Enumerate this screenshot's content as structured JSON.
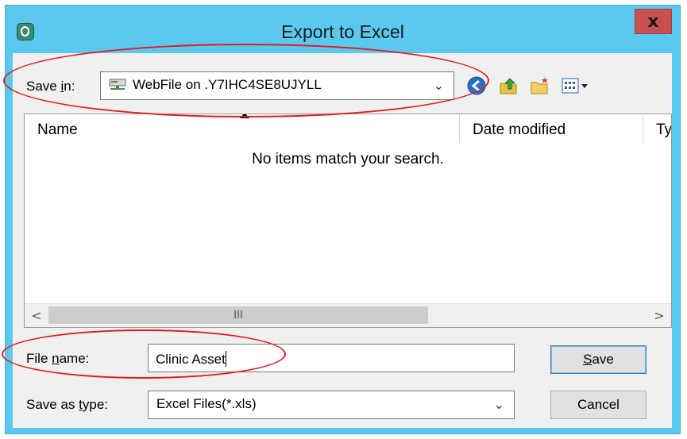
{
  "window": {
    "title": "Export to Excel",
    "close_label": "x"
  },
  "save_in": {
    "label_pre": "Save ",
    "label_accel": "i",
    "label_post": "n:",
    "value": "WebFile on .Y7IHC4SE8UJYLL",
    "location_icon": "network-drive-icon"
  },
  "toolbar": {
    "icons": [
      "back-icon",
      "up-folder-icon",
      "new-folder-icon",
      "view-menu-icon"
    ]
  },
  "file_list": {
    "columns": [
      "Name",
      "Date modified",
      "Ty"
    ],
    "empty_message": "No items match your search."
  },
  "scrollbar": {
    "left_arrow": "<",
    "right_arrow": ">",
    "thumb_grip": "III"
  },
  "file_name": {
    "label_pre": "File ",
    "label_accel": "n",
    "label_post": "ame:",
    "value": "Clinic Asset"
  },
  "save_as_type": {
    "label_pre": "Save as ",
    "label_accel": "t",
    "label_post": "ype:",
    "value": "Excel Files(*.xls)"
  },
  "buttons": {
    "save_accel": "S",
    "save_rest": "ave",
    "cancel": "Cancel"
  },
  "annotation_color": "#e21b1b"
}
